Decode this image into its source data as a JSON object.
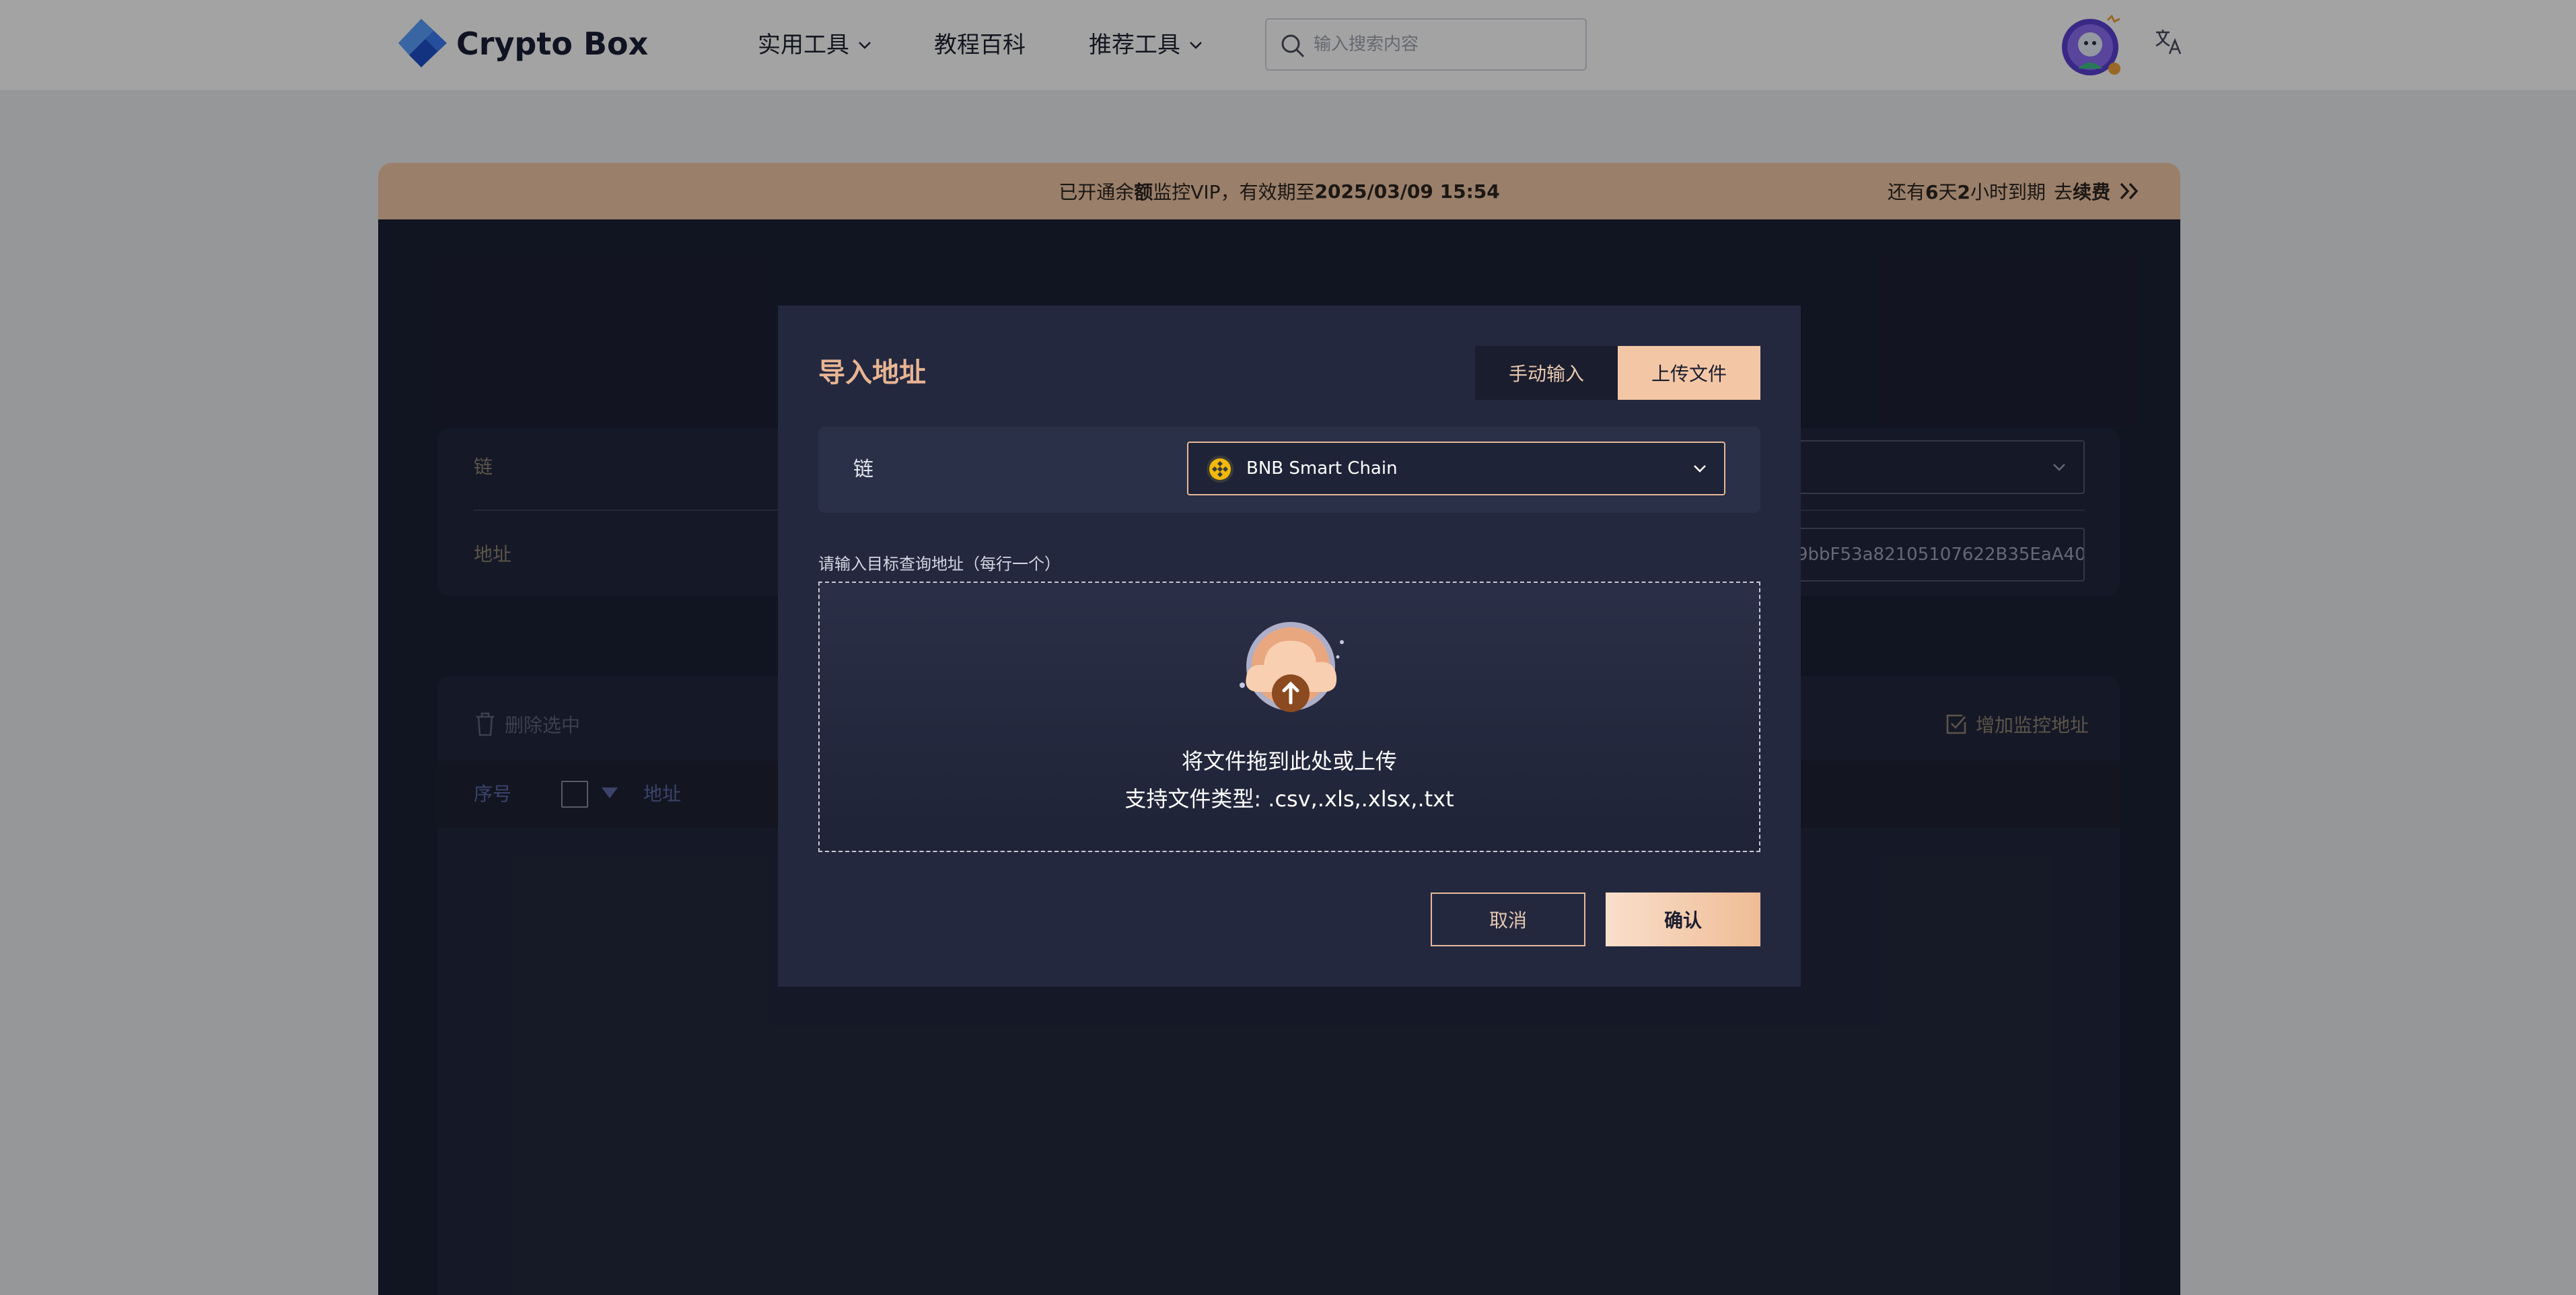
{
  "header": {
    "brand": "Crypto Box",
    "nav": [
      {
        "label": "实用工具",
        "dropdown": true
      },
      {
        "label": "教程百科",
        "dropdown": false
      },
      {
        "label": "推荐工具",
        "dropdown": true
      }
    ],
    "search_placeholder": "输入搜索内容"
  },
  "banner": {
    "prefix": "已开通余",
    "bold": "额",
    "mid": "监控VIP，有效期至",
    "date": "2025/03/09 15:54",
    "remain_prefix": "还有",
    "remain_days": "6",
    "remain_mid": "天",
    "remain_hours": "2",
    "remain_suffix": "小时到期",
    "renew_prefix": "去",
    "renew": "续费"
  },
  "background": {
    "chain_label": "链",
    "address_label": "地址",
    "address_value": "9bbF53a82105107622B35EaA40",
    "delete_selected": "删除选中",
    "add_monitor": "增加监控地址",
    "col_index": "序号",
    "col_address": "地址"
  },
  "modal": {
    "title": "导入地址",
    "tab_manual": "手动输入",
    "tab_upload": "上传文件",
    "chain_label": "链",
    "chain_value": "BNB Smart Chain",
    "hint": "请输入目标查询地址（每行一个）",
    "drop_text": "将文件拖到此处或上传",
    "drop_types": "支持文件类型: .csv,.xls,.xlsx,.txt",
    "cancel": "取消",
    "confirm": "确认"
  },
  "colors": {
    "accent": "#f3c7a6",
    "panel": "#1c2034",
    "modal": "#23283f"
  }
}
